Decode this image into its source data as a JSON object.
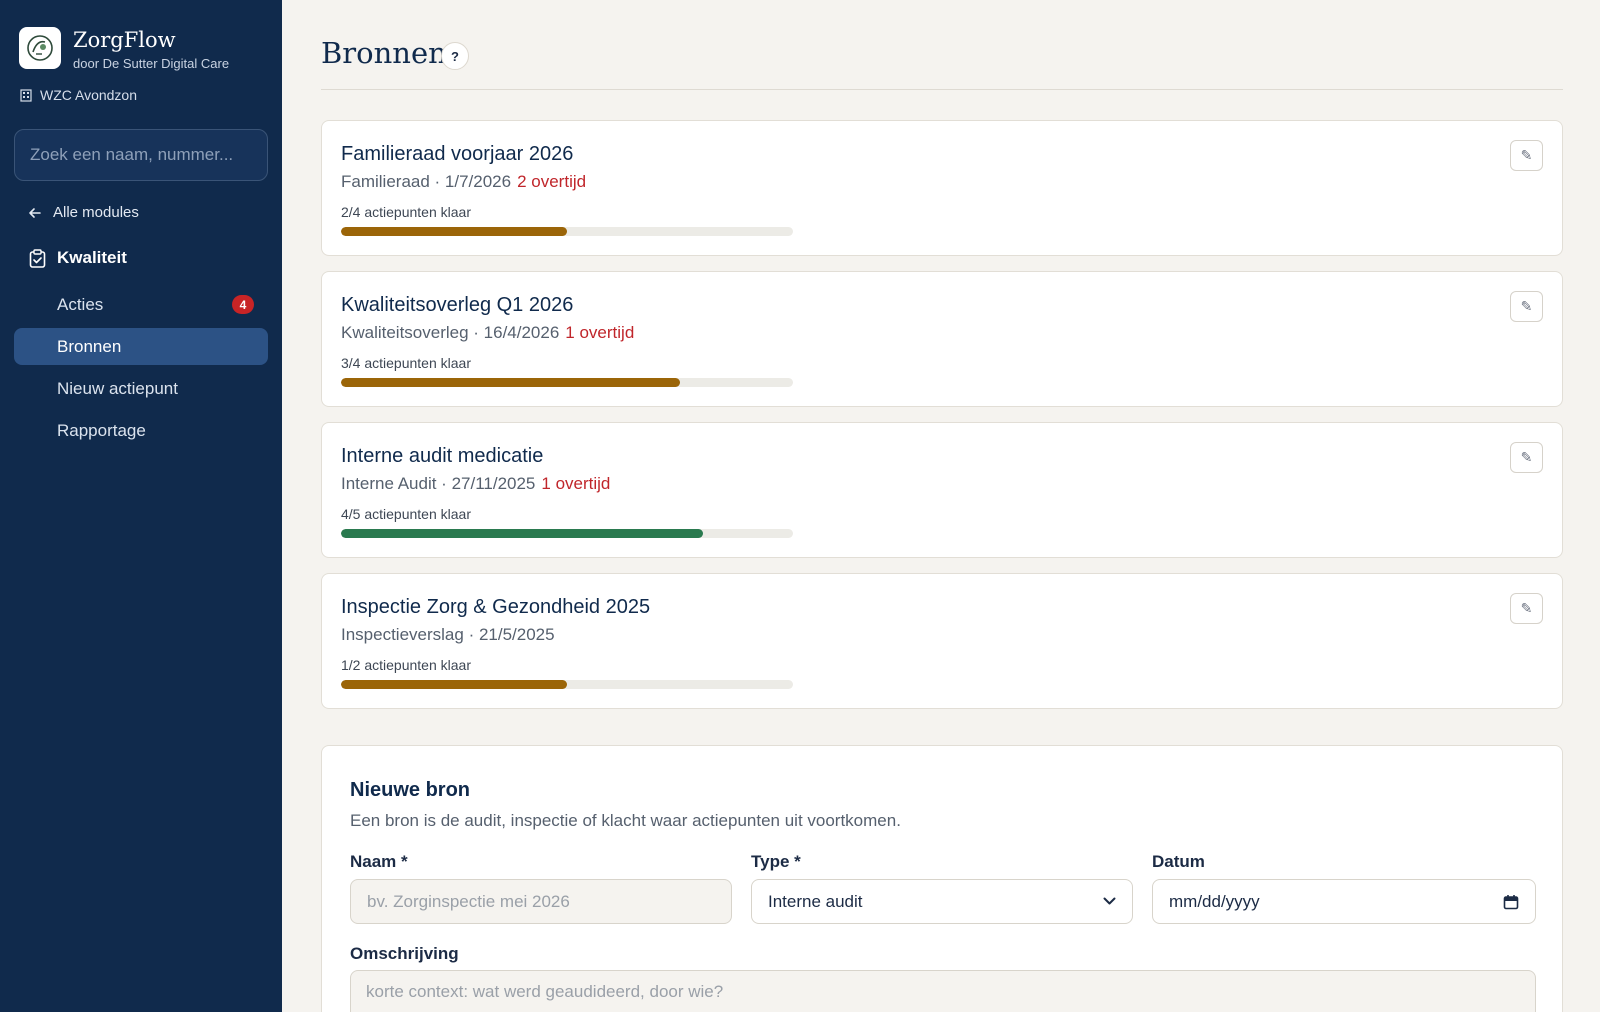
{
  "app": {
    "name": "ZorgFlow",
    "subtitle": "door De Sutter Digital Care",
    "facility": "WZC Avondzon"
  },
  "search": {
    "placeholder": "Zoek een naam, nummer..."
  },
  "sidebar": {
    "back_label": "Alle modules",
    "module_label": "Kwaliteit",
    "items": [
      {
        "label": "Acties",
        "badge": "4"
      },
      {
        "label": "Bronnen"
      },
      {
        "label": "Nieuw actiepunt"
      },
      {
        "label": "Rapportage"
      }
    ]
  },
  "page": {
    "title": "Bronnen",
    "help_label": "?"
  },
  "sources": [
    {
      "title": "Familieraad voorjaar 2026",
      "meta": "Familieraad · 1/7/2026",
      "overdue": "2 overtijd",
      "progress_text": "2/4 actiepunten klaar",
      "progress": 0.5,
      "color": "#9b6508"
    },
    {
      "title": "Kwaliteitsoverleg Q1 2026",
      "meta": "Kwaliteitsoverleg · 16/4/2026",
      "overdue": "1 overtijd",
      "progress_text": "3/4 actiepunten klaar",
      "progress": 0.75,
      "color": "#9b6508"
    },
    {
      "title": "Interne audit medicatie",
      "meta": "Interne Audit · 27/11/2025",
      "overdue": "1 overtijd",
      "progress_text": "4/5 actiepunten klaar",
      "progress": 0.8,
      "color": "#2a7a4f"
    },
    {
      "title": "Inspectie Zorg & Gezondheid 2025",
      "meta": "Inspectieverslag · 21/5/2025",
      "overdue": "",
      "progress_text": "1/2 actiepunten klaar",
      "progress": 0.5,
      "color": "#9b6508"
    }
  ],
  "form": {
    "title": "Nieuwe bron",
    "description": "Een bron is de audit, inspectie of klacht waar actiepunten uit voortkomen.",
    "name_label": "Naam *",
    "name_placeholder": "bv. Zorginspectie mei 2026",
    "type_label": "Type *",
    "type_value": "Interne audit",
    "date_label": "Datum",
    "date_value": "mm/dd/yyyy",
    "desc_label": "Omschrijving",
    "desc_placeholder": "korte context: wat werd geaudideerd, door wie?"
  },
  "colors": {
    "sidebar_bg": "#102a4c",
    "active_nav": "#2c5285",
    "overdue": "#c0262b",
    "badge": "#c82426"
  }
}
